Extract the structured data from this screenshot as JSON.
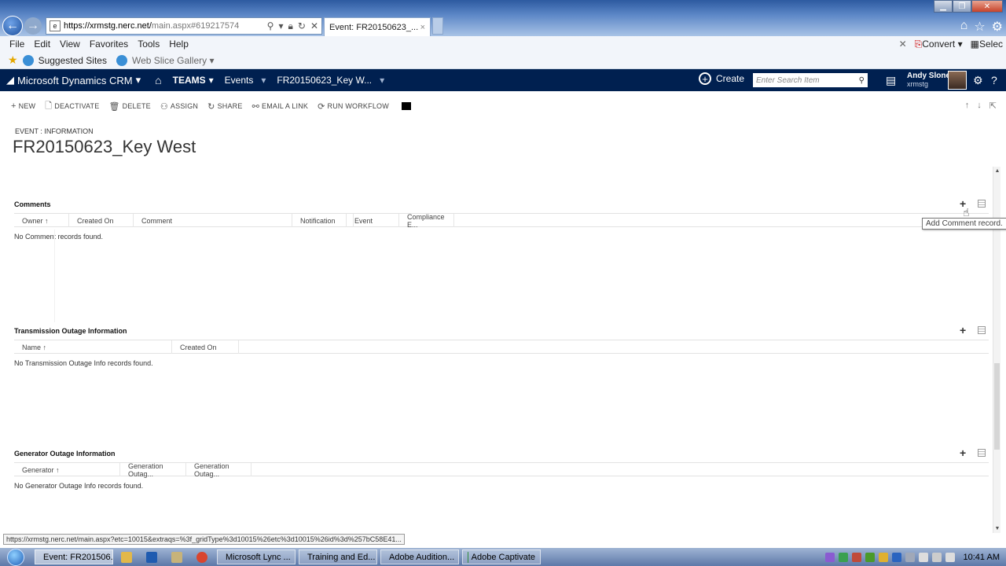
{
  "browser": {
    "url_main": "https://xrmstg.nerc.net/",
    "url_rest": "main.aspx#619217574",
    "active_tab": "Event: FR20150623_...",
    "menu": [
      "File",
      "Edit",
      "View",
      "Favorites",
      "Tools",
      "Help"
    ],
    "menu_right": {
      "convert": "Convert",
      "select": "Selec"
    },
    "favorites": {
      "suggested": "Suggested Sites",
      "webslice": "Web Slice Gallery"
    },
    "status_url": "https://xrmstg.nerc.net/main.aspx?etc=10015&extraqs=%3f_gridType%3d10015%26etc%3d10015%26id%3d%257bC58E41..."
  },
  "crm": {
    "app_name": "Microsoft Dynamics CRM",
    "area": "TEAMS",
    "entity": "Events",
    "record_crumb": "FR20150623_Key W...",
    "create": "Create",
    "search_placeholder": "Enter Search Item",
    "user_name": "Andy Slone",
    "user_org": "xrmstg"
  },
  "commands": [
    "NEW",
    "DEACTIVATE",
    "DELETE",
    "ASSIGN",
    "SHARE",
    "EMAIL A LINK",
    "RUN WORKFLOW"
  ],
  "record": {
    "entity_label": "EVENT : INFORMATION",
    "title": "FR20150623_Key West"
  },
  "sections": {
    "comments": {
      "title": "Comments",
      "columns": [
        "Owner ↑",
        "Created On",
        "Comment",
        "Notification",
        "Event",
        "Compliance E..."
      ],
      "empty": "No Comment records found."
    },
    "transmission": {
      "title": "Transmission Outage Information",
      "columns": [
        "Name ↑",
        "Created On"
      ],
      "empty": "No Transmission Outage Info records found."
    },
    "generator": {
      "title": "Generator Outage Information",
      "columns": [
        "Generator ↑",
        "Generation Outag...",
        "Generation Outag..."
      ],
      "empty": "No Generator Outage Info records found."
    }
  },
  "tooltip": "Add Comment record.",
  "taskbar": {
    "items": [
      "Event: FR201506...",
      "Microsoft Lync ...",
      "Training and Ed...",
      "Adobe Audition...",
      "Adobe Captivate"
    ],
    "clock": "10:41 AM"
  }
}
